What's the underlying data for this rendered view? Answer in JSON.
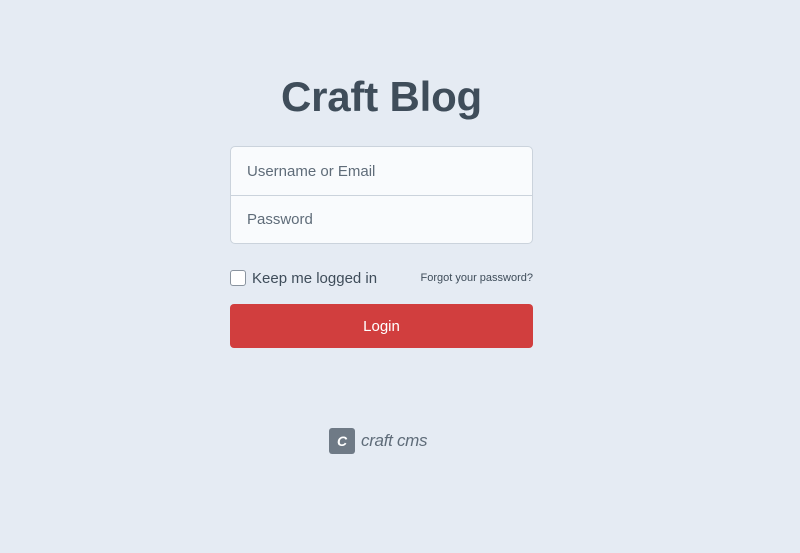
{
  "site": {
    "title": "Craft Blog"
  },
  "form": {
    "username": {
      "placeholder": "Username or Email",
      "value": ""
    },
    "password": {
      "placeholder": "Password",
      "value": ""
    },
    "remember": {
      "label": "Keep me logged in",
      "checked": false
    },
    "forgot_label": "Forgot your password?",
    "login_label": "Login"
  },
  "brand": {
    "mark": "C",
    "name": "craft cms"
  },
  "colors": {
    "background": "#e5ebf3",
    "title_text": "#3f4d5a",
    "login_button": "#d13e3e",
    "brand_mark": "#6f7a86"
  },
  "icons": {
    "checkbox": "unchecked-checkbox",
    "brand_logo": "craft-cms-logo"
  }
}
